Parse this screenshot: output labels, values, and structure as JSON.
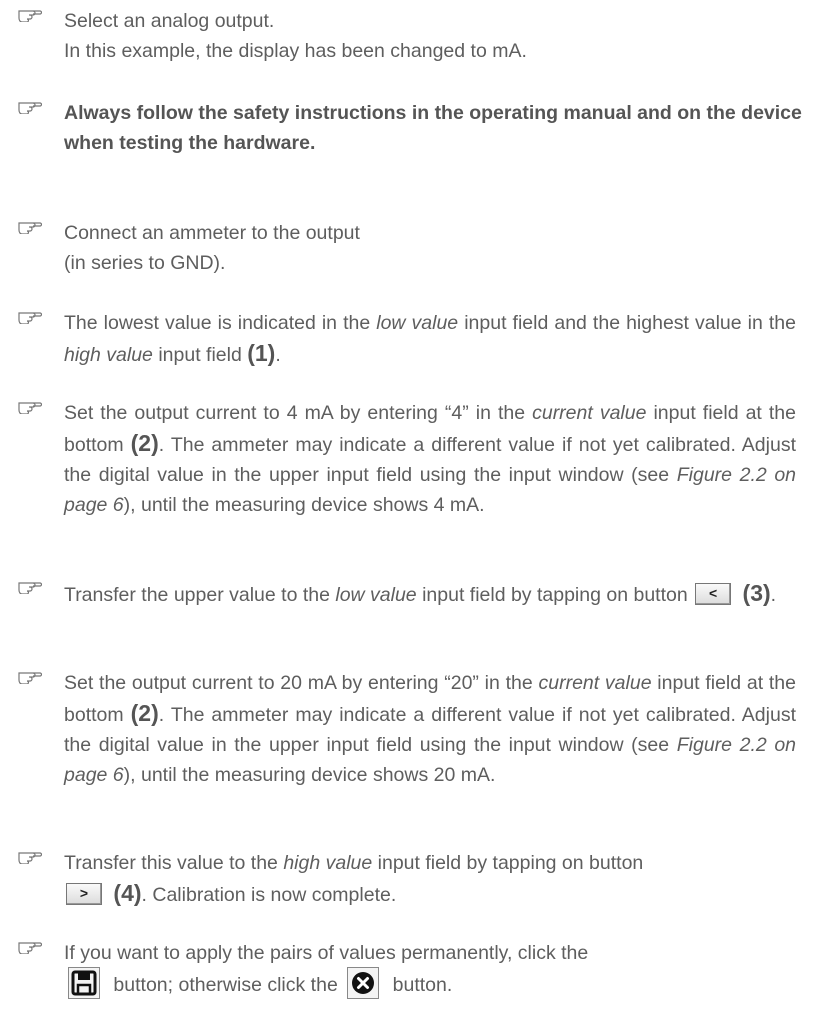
{
  "steps": [
    {
      "lines": [
        "Select an analog output.",
        "In this example, the display has been changed to mA."
      ]
    },
    {
      "bold": "Always follow the safety instructions in the operating manual and on the device when testing the hardware."
    },
    {
      "lines": [
        "Connect an ammeter to the output",
        "(in series to GND)."
      ]
    },
    {
      "t1": "The lowest value is indicated in the ",
      "e1": "low value",
      "t2": " input field and the highest value in the ",
      "e2": "high value",
      "t3": " input field ",
      "ref": "(1)",
      "t4": "."
    },
    {
      "t1": "Set the output current to 4 mA by entering “4” in the ",
      "e1": "current value",
      "t2": " input field at the bottom ",
      "ref": "(2)",
      "t3": ". The ammeter may indicate a different value if not yet calibrated. Adjust the digital value in the upper input field using the input window (see ",
      "e2": "Figure 2.2 on page 6",
      "t4": "), until the measuring device shows 4 mA."
    },
    {
      "t1": "Transfer the upper value to the ",
      "e1": "low value",
      "t2": " input field by tapping on button",
      "btn": "<",
      "ref": "(3)",
      "t3": "."
    },
    {
      "t1": "Set the output current to 20 mA by entering “20” in the ",
      "e1": "current value",
      "t2": " input field at the bottom ",
      "ref": "(2)",
      "t3": ". The ammeter may indicate a different value if not yet calibrated. Adjust the digital value in the upper input field using the input window (see ",
      "e2": "Figure 2.2 on page 6",
      "t4": "), until the measuring device shows 20 mA."
    },
    {
      "t1": "Transfer this value to the ",
      "e1": "high value",
      "t2": " input field by tapping on button",
      "btn": ">",
      "ref": "(4)",
      "t3": ". Calibration is now complete."
    },
    {
      "t1": "If you want to apply the pairs of values permanently, click the",
      "t2": "button; otherwise click the",
      "t3": "button.",
      "icon1": "save-icon",
      "icon2": "cancel-icon"
    }
  ]
}
